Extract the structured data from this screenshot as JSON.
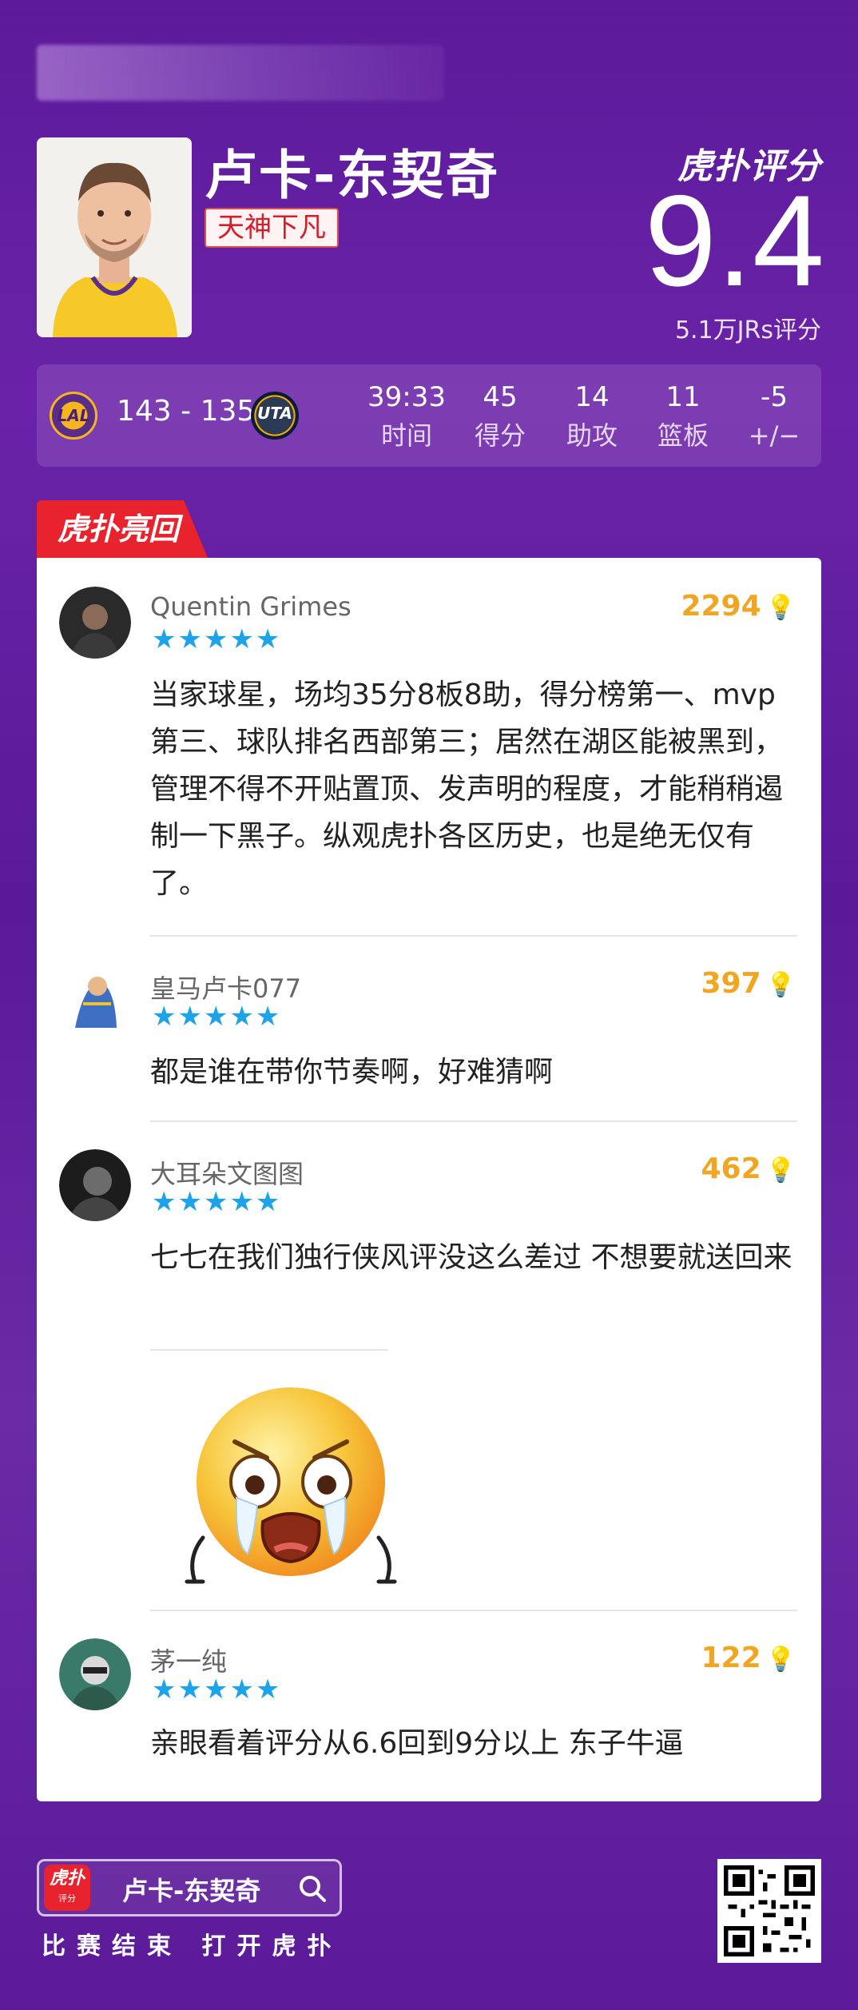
{
  "player": {
    "name": "卢卡-东契奇",
    "tag": "天神下凡"
  },
  "rating": {
    "brand": "虎扑评分",
    "score": "9.4",
    "count": "5.1万JRs评分"
  },
  "game": {
    "home_team": "LAL",
    "away_team": "UTA",
    "score": "143 - 135"
  },
  "stats": [
    {
      "value": "39:33",
      "label": "时间"
    },
    {
      "value": "45",
      "label": "得分"
    },
    {
      "value": "14",
      "label": "助攻"
    },
    {
      "value": "11",
      "label": "篮板"
    },
    {
      "value": "-5",
      "label": "+/−"
    }
  ],
  "hot_badge": "虎扑亮回复",
  "comments": [
    {
      "user": "Quentin Grimes",
      "stars": "★★★★★",
      "likes": "2294",
      "text": "当家球星，场均35分8板8助，得分榜第一、mvp第三、球队排名西部第三；居然在湖区能被黑到，管理不得不开贴置顶、发声明的程度，才能稍稍遏制一下黑子。纵观虎扑各区历史，也是绝无仅有了。"
    },
    {
      "user": "皇马卢卡077",
      "stars": "★★★★★",
      "likes": "397",
      "text": "都是谁在带你节奏啊，好难猜啊"
    },
    {
      "user": "大耳朵文图图",
      "stars": "★★★★★",
      "likes": "462",
      "text": "七七在我们独行侠风评没这么差过 不想要就送回来"
    },
    {
      "user": "茅一纯",
      "stars": "★★★★★",
      "likes": "122",
      "text": "亲眼看着评分从6.6回到9分以上 东子牛逼"
    }
  ],
  "footer": {
    "search_label": "卢卡-东契奇",
    "app_icon_text": "虎扑",
    "app_icon_sub": "评分",
    "cta": "比赛结束 打开虎扑"
  },
  "colors": {
    "background": "#5c1a9a",
    "accent_red": "#e8232d",
    "like_gold": "#f0a623",
    "star_blue": "#1fa3e8"
  }
}
